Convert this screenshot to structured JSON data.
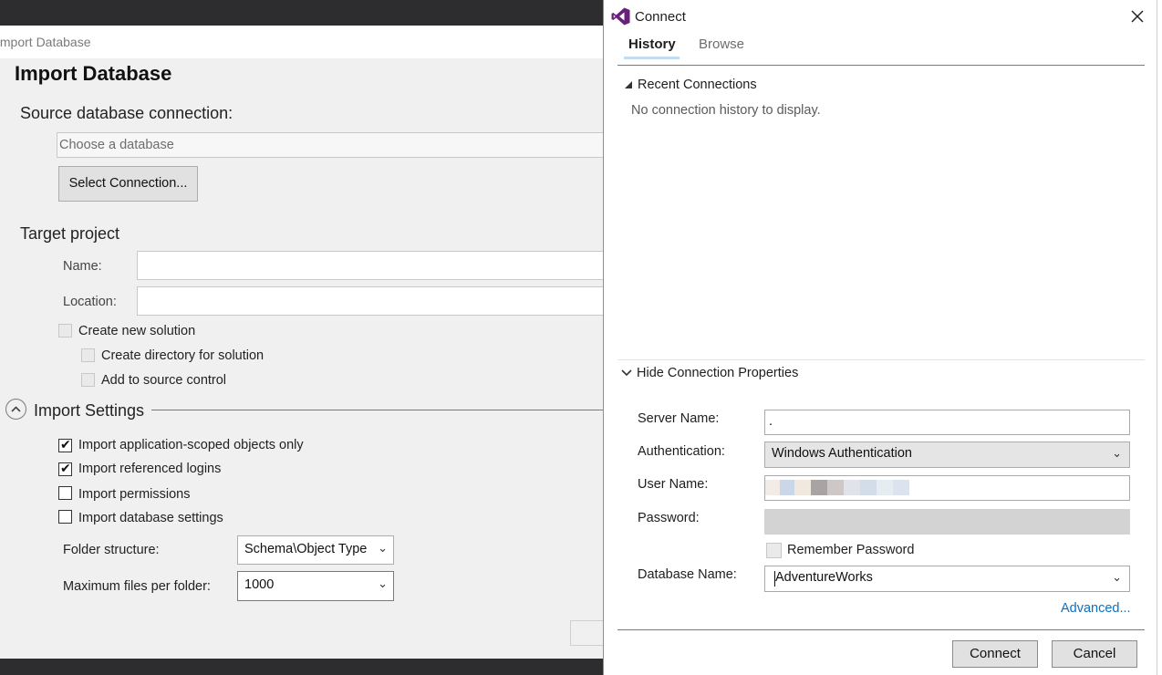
{
  "import_dialog": {
    "window_title": "Import Database",
    "heading": "Import Database",
    "source_label": "Source database connection:",
    "database_placeholder": "Choose a database",
    "select_connection_label": "Select Connection...",
    "target_project_label": "Target project",
    "name_label": "Name:",
    "location_label": "Location:",
    "create_solution_label": "Create new solution",
    "create_directory_label": "Create directory for solution",
    "source_control_label": "Add to source control",
    "import_settings_label": "Import Settings",
    "options": [
      {
        "label": "Import application-scoped objects only",
        "checked": true
      },
      {
        "label": "Import referenced logins",
        "checked": true
      },
      {
        "label": "Import permissions",
        "checked": false
      },
      {
        "label": "Import database settings",
        "checked": false
      }
    ],
    "folder_structure_label": "Folder structure:",
    "folder_structure_value": "Schema\\Object Type",
    "max_files_label": "Maximum files per folder:",
    "max_files_value": "1000"
  },
  "connect_dialog": {
    "title": "Connect",
    "tabs": [
      "History",
      "Browse"
    ],
    "active_tab": "History",
    "recent_connections_label": "Recent Connections",
    "no_history_text": "No connection history to display.",
    "hide_properties_label": "Hide Connection Properties",
    "server_name_label": "Server Name:",
    "server_name_value": ".",
    "authentication_label": "Authentication:",
    "authentication_value": "Windows Authentication",
    "user_name_label": "User Name:",
    "password_label": "Password:",
    "remember_password_label": "Remember Password",
    "database_name_label": "Database Name:",
    "database_name_value": "AdventureWorks",
    "advanced_link": "Advanced...",
    "connect_button": "Connect",
    "cancel_button": "Cancel"
  },
  "colors": {
    "accent": "#0e70c0",
    "vs_purple": "#68217a",
    "tab_underline": "#c3dcf1"
  }
}
